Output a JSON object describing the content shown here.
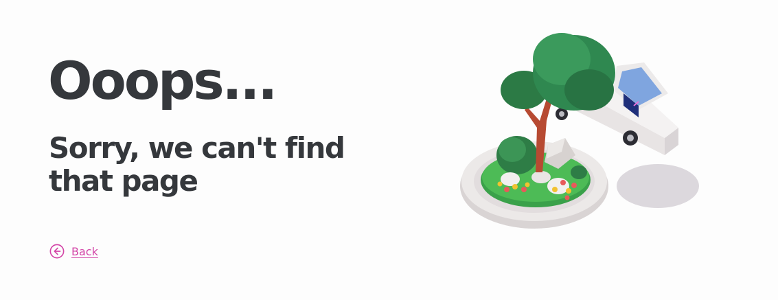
{
  "heading": "Ooops...",
  "subheading": "Sorry, we can't find that page",
  "back_link": {
    "label": "Back",
    "icon": "arrow-left-circle-icon"
  },
  "illustration": {
    "description_icon": "tree-and-car-illustration"
  },
  "colors": {
    "text": "#35383c",
    "accent": "#d345a7",
    "background": "#fdfdfd"
  }
}
